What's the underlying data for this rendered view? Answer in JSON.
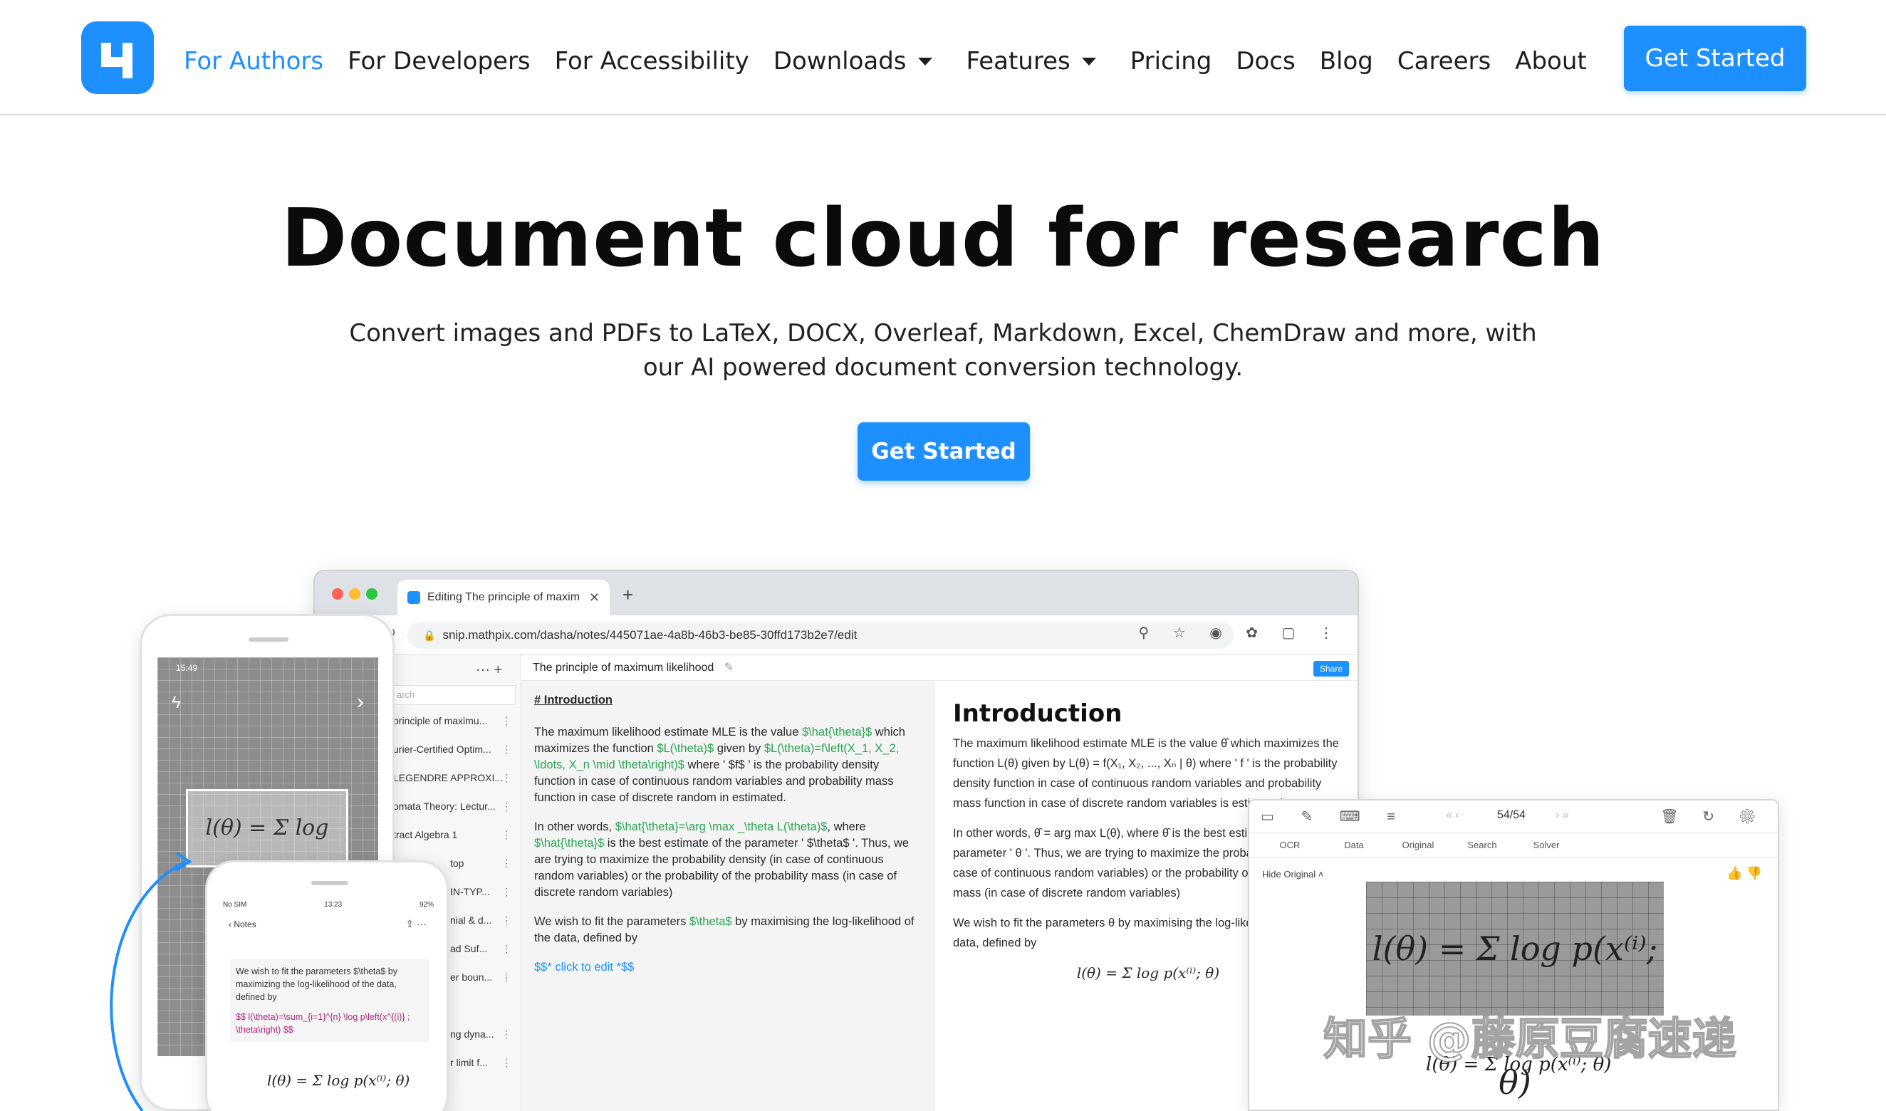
{
  "nav": {
    "links": [
      {
        "label": "For Authors"
      },
      {
        "label": "For Developers"
      },
      {
        "label": "For Accessibility"
      },
      {
        "label": "Downloads"
      },
      {
        "label": "Features"
      },
      {
        "label": "Pricing"
      },
      {
        "label": "Docs"
      },
      {
        "label": "Blog"
      },
      {
        "label": "Careers"
      },
      {
        "label": "About"
      }
    ],
    "cta": "Get Started"
  },
  "hero": {
    "title": "Document cloud for research",
    "subtitle_line1": "Convert images and PDFs to LaTeX, DOCX, Overleaf, Markdown, Excel, ChemDraw and more, with",
    "subtitle_line2": "our AI powered document conversion technology.",
    "cta": "Get Started"
  },
  "browser": {
    "tab_title": "Editing The principle of maxim",
    "url": "snip.mathpix.com/dasha/notes/445071ae-4a8b-46b3-be85-30ffd173b2e7/edit",
    "doc_title": "The principle of maximum likelihood",
    "share_label": "Share",
    "search_placeholder": "arch",
    "sidebar_items": [
      "principle of maximu...",
      "urier-Certified Optim...",
      "LEGENDRE APPROXI...",
      "omata Theory: Lectur...",
      "tract Algebra 1",
      "top",
      "IN-TYP...",
      "nial & d...",
      "ad Suf...",
      "er boun...",
      "ng dyna...",
      "r limit f..."
    ],
    "editor": {
      "heading": "# Introduction",
      "p1a": "The maximum likelihood estimate MLE is the value ",
      "p1b": "$\\hat{\\theta}$",
      "p1c": " which maximizes the function ",
      "p1d": "$L(\\theta)$",
      "p1e": " given by ",
      "p1f": "$L(\\theta)=f\\left(X_1, X_2, \\ldots, X_n \\mid \\theta\\right)$",
      "p1g": " where ' $f$ ' is the probability density function in case of continuous random variables and probability mass function in case of discrete random in estimated.",
      "p2a": "In other words, ",
      "p2b": "$\\hat{\\theta}=\\arg \\max _\\theta L(\\theta)$",
      "p2c": ", where ",
      "p2d": "$\\hat{\\theta}$",
      "p2e": " is the best estimate of the parameter ' $\\theta$ '. Thus, we are trying to maximize the probability density (in case of continuous random variables) or the probability of the probability mass (in case of discrete random variables)",
      "p3a": "We wish to fit the parameters ",
      "p3b": "$\\theta$",
      "p3c": " by maximising the log-likelihood of the data, defined by",
      "p4": "$$* click to edit *$$"
    },
    "preview": {
      "heading": "Introduction",
      "p1": "The maximum likelihood estimate MLE is the value θ̂ which maximizes the function L(θ) given by L(θ) = f(X₁, X₂, ..., Xₙ | θ) where ' f ' is the probability density function in case of continuous random variables and probability mass function in case of discrete random variables is estimated.",
      "p2": "In other words, θ̂ = arg max L(θ), where θ̂ is the best estimate of the parameter ' θ '. Thus, we are trying to maximize the probability density (in case of continuous random variables) or the probability of the probability mass (in case of discrete random variables)",
      "p3": "We wish to fit the parameters θ by maximising the log-likelihood of the data, defined by",
      "formula": "l(θ) = Σ log p(x⁽ⁱ⁾; θ)"
    }
  },
  "phone_back": {
    "time": "15:49",
    "handwriting": "l(θ) = Σ log p(x⁽ⁱ⁾, θ)"
  },
  "phone_front": {
    "carrier": "No SIM",
    "time": "13:23",
    "battery": "92%",
    "back_label": "Notes",
    "text": "We wish to fit the parameters $\\theta$ by maximizing the log-likelihood of the data, defined by",
    "code": "$$ l(\\theta)=\\sum_{i=1}^{n} \\log p\\left(x^{(i)} ; \\theta\\right) $$",
    "formula": "l(θ) = Σ log p(x⁽ⁱ⁾; θ)"
  },
  "ocr_panel": {
    "page": "54/54",
    "tabs": [
      "OCR",
      "Data",
      "Original",
      "Search",
      "Solver"
    ],
    "hide_original": "Hide Original",
    "handwriting": "l(θ) = Σ log p(x⁽ⁱ⁾; θ)",
    "formula": "l(θ) = Σ log p(x⁽ⁱ⁾; θ)"
  },
  "watermark": "知乎 @藤原豆腐速递",
  "colors": {
    "accent": "#1e8fff",
    "text": "#111111",
    "editor_bg": "#f4f4f5",
    "latex_green": "#2aa44f"
  }
}
